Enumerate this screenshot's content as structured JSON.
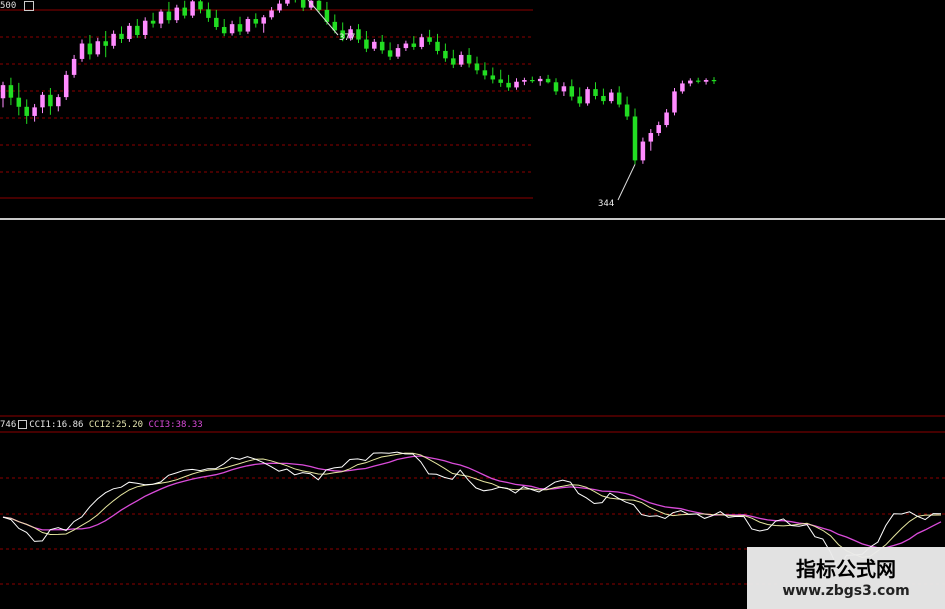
{
  "price_panel": {
    "header_text": "500",
    "high_label": "377",
    "low_label": "344",
    "colors": {
      "up": "#ff8cff",
      "down": "#22dd22",
      "grid": "#8b0000",
      "divider": "#c8c8c8"
    },
    "candles": [
      [
        357.5,
        360.4,
        355.9,
        359.8
      ],
      [
        359.8,
        361.1,
        356.3,
        357.6
      ],
      [
        357.6,
        360.2,
        354.5,
        356.0
      ],
      [
        356.0,
        357.3,
        353.0,
        354.4
      ],
      [
        354.4,
        356.5,
        353.4,
        355.9
      ],
      [
        355.9,
        358.6,
        354.9,
        358.1
      ],
      [
        358.1,
        359.3,
        354.6,
        356.1
      ],
      [
        356.1,
        358.2,
        355.2,
        357.7
      ],
      [
        357.7,
        362.3,
        357.2,
        361.6
      ],
      [
        361.6,
        365.1,
        361.1,
        364.4
      ],
      [
        364.4,
        367.8,
        363.9,
        367.1
      ],
      [
        367.1,
        368.6,
        364.3,
        365.2
      ],
      [
        365.2,
        368.1,
        364.8,
        367.5
      ],
      [
        367.5,
        369.3,
        364.7,
        366.7
      ],
      [
        366.7,
        369.4,
        366.2,
        368.8
      ],
      [
        368.8,
        370.1,
        367.2,
        367.9
      ],
      [
        367.9,
        370.7,
        367.4,
        370.2
      ],
      [
        370.2,
        371.4,
        368.1,
        368.6
      ],
      [
        368.6,
        371.7,
        367.9,
        371.1
      ],
      [
        371.1,
        372.5,
        369.9,
        370.6
      ],
      [
        370.6,
        373.1,
        369.8,
        372.7
      ],
      [
        372.7,
        374.4,
        370.6,
        371.2
      ],
      [
        371.2,
        373.9,
        370.7,
        373.4
      ],
      [
        373.4,
        374.6,
        371.5,
        372.0
      ],
      [
        372.0,
        375.0,
        371.6,
        374.5
      ],
      [
        374.5,
        375.9,
        372.4,
        373.1
      ],
      [
        373.1,
        374.3,
        370.9,
        371.6
      ],
      [
        371.6,
        373.0,
        369.5,
        370.0
      ],
      [
        370.0,
        371.4,
        368.4,
        368.9
      ],
      [
        368.9,
        371.1,
        368.5,
        370.5
      ],
      [
        370.5,
        371.8,
        368.6,
        369.2
      ],
      [
        369.2,
        371.8,
        368.8,
        371.4
      ],
      [
        371.4,
        372.4,
        369.9,
        370.6
      ],
      [
        370.6,
        372.1,
        369.0,
        371.7
      ],
      [
        371.7,
        373.5,
        371.3,
        372.9
      ],
      [
        372.9,
        374.7,
        372.5,
        374.1
      ],
      [
        374.1,
        376.7,
        373.7,
        375.9
      ],
      [
        375.9,
        377.4,
        374.3,
        374.8
      ],
      [
        374.8,
        376.1,
        372.8,
        373.4
      ],
      [
        373.4,
        375.2,
        373.0,
        374.6
      ],
      [
        374.6,
        375.8,
        372.5,
        373.0
      ],
      [
        373.0,
        374.4,
        370.4,
        370.9
      ],
      [
        370.9,
        372.2,
        368.9,
        369.4
      ],
      [
        369.4,
        370.8,
        367.5,
        368.0
      ],
      [
        368.0,
        370.2,
        367.6,
        369.6
      ],
      [
        369.6,
        370.5,
        367.2,
        367.8
      ],
      [
        367.8,
        369.3,
        365.6,
        366.2
      ],
      [
        366.2,
        367.9,
        365.8,
        367.4
      ],
      [
        367.4,
        368.6,
        365.3,
        365.9
      ],
      [
        365.9,
        367.3,
        364.2,
        364.8
      ],
      [
        364.8,
        367.0,
        364.4,
        366.3
      ],
      [
        366.3,
        367.6,
        365.8,
        367.1
      ],
      [
        367.1,
        368.4,
        366.0,
        366.5
      ],
      [
        366.5,
        368.8,
        366.1,
        368.2
      ],
      [
        368.2,
        369.5,
        366.9,
        367.4
      ],
      [
        367.4,
        368.8,
        365.2,
        365.8
      ],
      [
        365.8,
        367.1,
        363.9,
        364.5
      ],
      [
        364.5,
        366.0,
        362.8,
        363.4
      ],
      [
        363.4,
        365.7,
        363.0,
        365.1
      ],
      [
        365.1,
        366.3,
        362.9,
        363.6
      ],
      [
        363.6,
        364.8,
        361.7,
        362.4
      ],
      [
        362.4,
        363.8,
        360.8,
        361.5
      ],
      [
        361.5,
        362.9,
        360.1,
        360.8
      ],
      [
        360.8,
        362.5,
        359.5,
        360.2
      ],
      [
        360.2,
        361.6,
        358.8,
        359.4
      ],
      [
        359.4,
        361.0,
        359.0,
        360.4
      ],
      [
        360.4,
        361.1,
        359.8,
        360.7
      ],
      [
        360.7,
        361.3,
        360.2,
        360.5
      ],
      [
        360.5,
        361.4,
        359.7,
        360.9
      ],
      [
        360.9,
        361.6,
        360.1,
        360.3
      ],
      [
        360.3,
        361.0,
        358.1,
        358.7
      ],
      [
        358.7,
        360.3,
        357.9,
        359.6
      ],
      [
        359.6,
        360.8,
        357.1,
        357.8
      ],
      [
        357.8,
        359.4,
        356.0,
        356.6
      ],
      [
        356.6,
        359.5,
        356.2,
        359.1
      ],
      [
        359.1,
        360.3,
        357.3,
        357.9
      ],
      [
        357.9,
        359.2,
        356.4,
        357.0
      ],
      [
        357.0,
        359.1,
        356.6,
        358.5
      ],
      [
        358.5,
        359.6,
        355.9,
        356.4
      ],
      [
        356.4,
        357.8,
        353.7,
        354.3
      ],
      [
        354.3,
        355.7,
        345.9,
        346.6
      ],
      [
        346.6,
        350.6,
        346.0,
        349.9
      ],
      [
        349.9,
        352.1,
        348.3,
        351.4
      ],
      [
        351.4,
        353.4,
        350.9,
        352.8
      ],
      [
        352.8,
        355.6,
        352.4,
        355.0
      ],
      [
        355.0,
        359.3,
        354.5,
        358.7
      ],
      [
        358.7,
        360.6,
        358.3,
        360.1
      ],
      [
        360.1,
        361.0,
        359.6,
        360.6
      ],
      [
        360.6,
        361.1,
        360.1,
        360.4
      ],
      [
        360.4,
        361.0,
        359.9,
        360.7
      ],
      [
        360.7,
        361.2,
        360.0,
        360.5
      ]
    ]
  },
  "cci_panel": {
    "header": {
      "prefix": "746",
      "cci1": "CCI1:16.86",
      "cci2": "CCI2:25.20",
      "cci3": "CCI3:38.33"
    },
    "colors": {
      "cci1": "#ffffff",
      "cci2": "#e6e6a0",
      "cci3": "#d94bd9",
      "grid": "#8b0000"
    }
  },
  "watermark": {
    "title": "指标公式网",
    "url": "www.zbgs3.com"
  }
}
